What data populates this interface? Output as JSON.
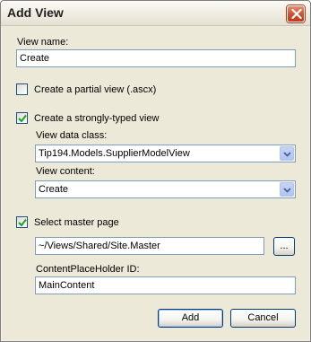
{
  "window": {
    "title": "Add View"
  },
  "form": {
    "view_name_label": "View name:",
    "view_name_value": "Create",
    "partial_view_label": "Create a partial view (.ascx)",
    "partial_view_checked": false,
    "strongly_typed_label": "Create a strongly-typed view",
    "strongly_typed_checked": true,
    "view_data_class_label": "View data class:",
    "view_data_class_value": "Tip194.Models.SupplierModelView",
    "view_content_label": "View content:",
    "view_content_value": "Create",
    "master_page_label": "Select master page",
    "master_page_checked": true,
    "master_page_value": "~/Views/Shared/Site.Master",
    "browse_label": "...",
    "placeholder_id_label": "ContentPlaceHolder ID:",
    "placeholder_id_value": "MainContent"
  },
  "buttons": {
    "add": "Add",
    "cancel": "Cancel"
  },
  "icons": {
    "close": "close-icon",
    "check": "checkmark-icon",
    "dropdown": "chevron-down-icon"
  },
  "colors": {
    "dialog_bg": "#ece9d8",
    "close_red": "#d1522f",
    "field_border": "#7f9db9",
    "check_green": "#21a121"
  }
}
